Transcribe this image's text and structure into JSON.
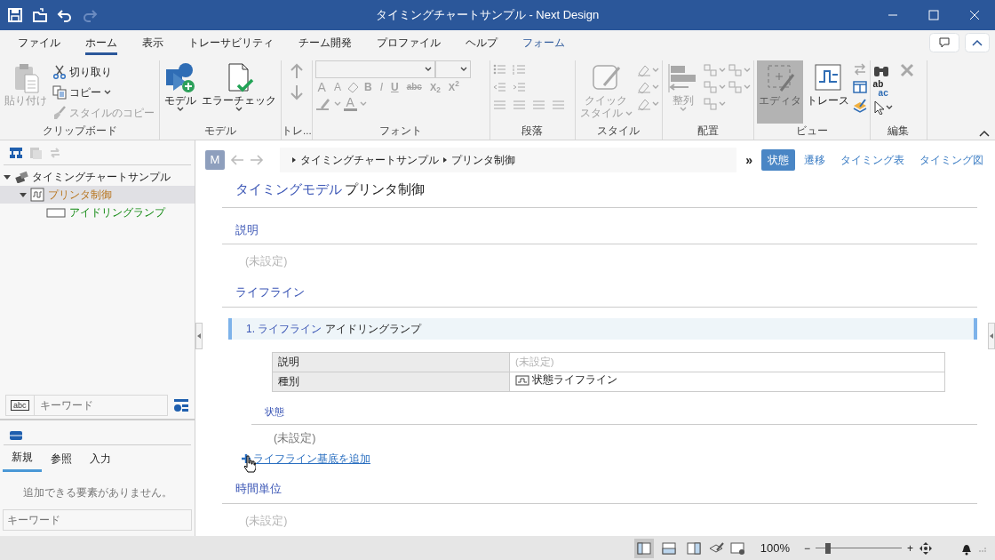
{
  "title_bar": {
    "title": "タイミングチャートサンプル - Next Design"
  },
  "ribbon_tabs": [
    {
      "label": "ファイル",
      "selected": false,
      "kind": "normal"
    },
    {
      "label": "ホーム",
      "selected": true,
      "kind": "normal"
    },
    {
      "label": "表示",
      "selected": false,
      "kind": "normal"
    },
    {
      "label": "トレーサビリティ",
      "selected": false,
      "kind": "normal"
    },
    {
      "label": "チーム開発",
      "selected": false,
      "kind": "normal"
    },
    {
      "label": "プロファイル",
      "selected": false,
      "kind": "normal"
    },
    {
      "label": "ヘルプ",
      "selected": false,
      "kind": "normal"
    },
    {
      "label": "フォーム",
      "selected": false,
      "kind": "contextual"
    }
  ],
  "ribbon_groups": [
    {
      "label": "クリップボード",
      "buttons": [
        {
          "label": "貼り付け",
          "disabled": true,
          "dropdown": false
        },
        {
          "label": "切り取り",
          "disabled": false,
          "dropdown": false
        },
        {
          "label": "コピー",
          "disabled": false,
          "dropdown": true
        },
        {
          "label": "スタイルのコピー",
          "disabled": true,
          "dropdown": false
        }
      ]
    },
    {
      "label": "モデル",
      "buttons": [
        {
          "label": "モデル",
          "disabled": false,
          "dropdown": true
        },
        {
          "label": "エラーチェック",
          "disabled": false,
          "dropdown": true
        }
      ]
    },
    {
      "label": "トレ..."
    },
    {
      "label": "フォント",
      "glyphs": [
        "A",
        "A",
        "B",
        "I",
        "U",
        "abc",
        "X$_{2}$",
        "X$^{2}$",
        "A"
      ]
    },
    {
      "label": "段落"
    },
    {
      "label": "スタイル",
      "buttons": [
        {
          "label_lines": [
            "クイック",
            "スタイル"
          ],
          "disabled": true,
          "dropdown": true
        }
      ]
    },
    {
      "label": "配置",
      "buttons": [
        {
          "label": "整列",
          "disabled": true,
          "dropdown": true
        }
      ]
    },
    {
      "label": "ビュー",
      "buttons": [
        {
          "label": "エディタ",
          "selected": true
        },
        {
          "label": "トレース",
          "selected": false
        }
      ]
    },
    {
      "label": "編集",
      "glyphs": [
        "ab",
        "ac"
      ]
    }
  ],
  "model_tree": {
    "items": [
      {
        "label": "タイミングチャートサンプル",
        "expanded": true,
        "selected": false,
        "kind": "package",
        "children": [
          {
            "label": "プリンタ制御",
            "expanded": true,
            "selected": true,
            "kind": "model",
            "children": [
              {
                "label": "アイドリングランプ",
                "selected": false,
                "kind": "lifeline"
              }
            ]
          }
        ]
      }
    ]
  },
  "tree_search": {
    "glyph": "abc",
    "placeholder": "キーワード"
  },
  "toolbox": {
    "tabs": [
      {
        "label": "新規",
        "selected": true
      },
      {
        "label": "参照",
        "selected": false
      },
      {
        "label": "入力",
        "selected": false
      }
    ],
    "message": "追加できる要素がありません。",
    "search": {
      "placeholder": "キーワード"
    }
  },
  "editor": {
    "avatar": "M",
    "breadcrumb": [
      "タイミングチャートサンプル",
      "プリンタ制御"
    ],
    "more": "»",
    "view_tabs": [
      {
        "label": "状態",
        "selected": true
      },
      {
        "label": "遷移",
        "selected": false
      },
      {
        "label": "タイミング表",
        "selected": false
      },
      {
        "label": "タイミング図",
        "selected": false
      }
    ],
    "heading": {
      "kind_label": "タイミングモデル",
      "name": "プリンタ制御"
    },
    "description": {
      "title": "説明",
      "value": "(未設定)"
    },
    "lifelines": {
      "title": "ライフライン",
      "items": [
        {
          "number": "1.",
          "kind_label": "ライフライン",
          "name": "アイドリングランプ",
          "properties": [
            {
              "name": "説明",
              "value": "(未設定)",
              "unset": true
            },
            {
              "name": "種別",
              "value": "状態ライフライン",
              "unset": false
            }
          ],
          "states": {
            "title": "状態",
            "value": "(未設定)"
          }
        }
      ],
      "add_link": "ライフライン基底を追加"
    },
    "time_unit": {
      "title": "時間単位",
      "value": "(未設定)"
    }
  },
  "status_bar": {
    "layouts": [
      {
        "selected": true
      },
      {
        "selected": false
      },
      {
        "selected": false
      }
    ],
    "zoom": "100%",
    "zoom_out": "−",
    "zoom_in": "+",
    "zoom_slider": {
      "level": 0.12
    }
  }
}
